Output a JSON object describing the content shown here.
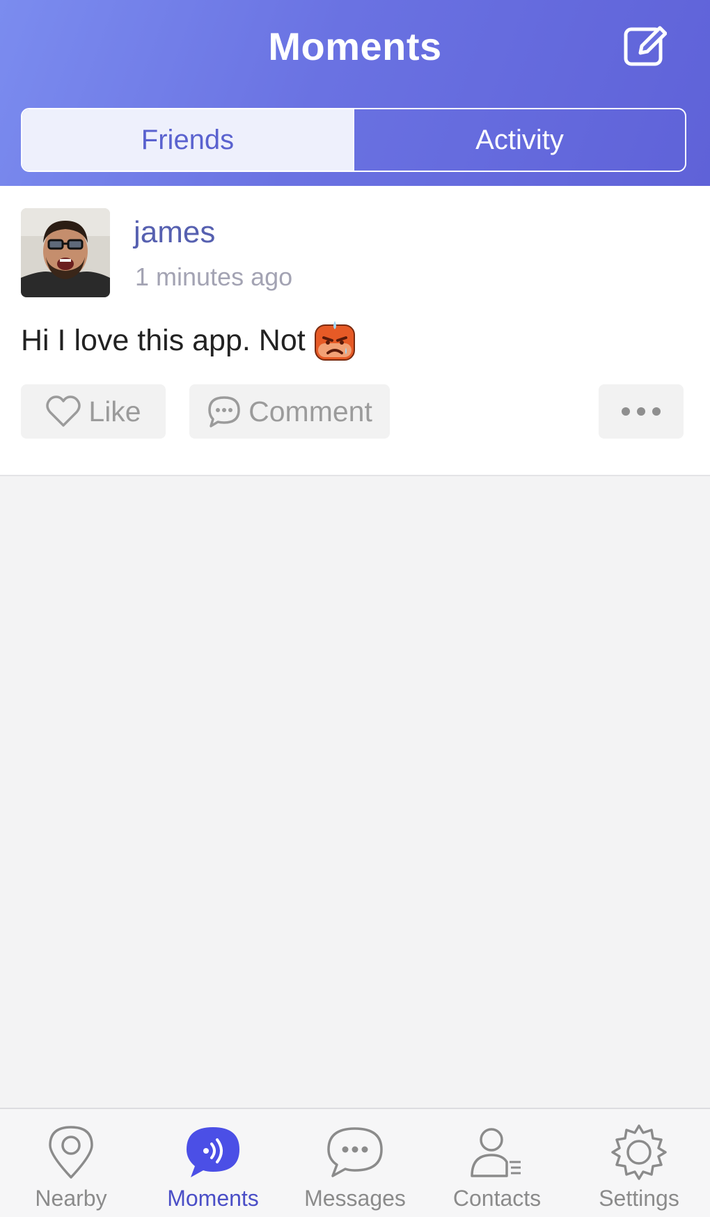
{
  "header": {
    "title": "Moments"
  },
  "segments": {
    "friends": "Friends",
    "activity": "Activity"
  },
  "post": {
    "username": "james",
    "timestamp": "1 minutes ago",
    "text": "Hi I love this app. Not",
    "like_label": "Like",
    "comment_label": "Comment"
  },
  "tabbar": {
    "nearby": "Nearby",
    "moments": "Moments",
    "messages": "Messages",
    "contacts": "Contacts",
    "settings": "Settings"
  },
  "colors": {
    "header_gradient_start": "#7b8cef",
    "header_gradient_end": "#5f62d8",
    "accent": "#4b4fc7"
  }
}
